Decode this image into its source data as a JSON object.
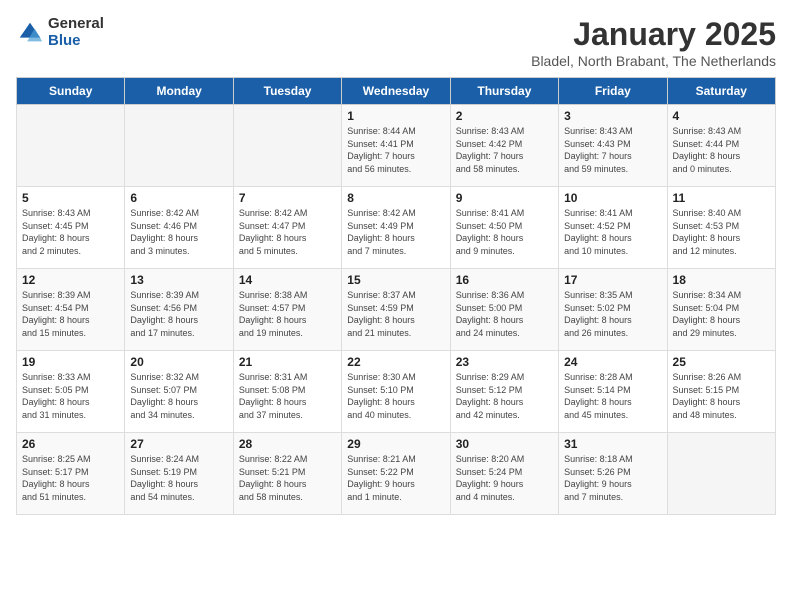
{
  "logo": {
    "general": "General",
    "blue": "Blue"
  },
  "header": {
    "title": "January 2025",
    "subtitle": "Bladel, North Brabant, The Netherlands"
  },
  "days_of_week": [
    "Sunday",
    "Monday",
    "Tuesday",
    "Wednesday",
    "Thursday",
    "Friday",
    "Saturday"
  ],
  "weeks": [
    [
      {
        "day": "",
        "info": ""
      },
      {
        "day": "",
        "info": ""
      },
      {
        "day": "",
        "info": ""
      },
      {
        "day": "1",
        "info": "Sunrise: 8:44 AM\nSunset: 4:41 PM\nDaylight: 7 hours\nand 56 minutes."
      },
      {
        "day": "2",
        "info": "Sunrise: 8:43 AM\nSunset: 4:42 PM\nDaylight: 7 hours\nand 58 minutes."
      },
      {
        "day": "3",
        "info": "Sunrise: 8:43 AM\nSunset: 4:43 PM\nDaylight: 7 hours\nand 59 minutes."
      },
      {
        "day": "4",
        "info": "Sunrise: 8:43 AM\nSunset: 4:44 PM\nDaylight: 8 hours\nand 0 minutes."
      }
    ],
    [
      {
        "day": "5",
        "info": "Sunrise: 8:43 AM\nSunset: 4:45 PM\nDaylight: 8 hours\nand 2 minutes."
      },
      {
        "day": "6",
        "info": "Sunrise: 8:42 AM\nSunset: 4:46 PM\nDaylight: 8 hours\nand 3 minutes."
      },
      {
        "day": "7",
        "info": "Sunrise: 8:42 AM\nSunset: 4:47 PM\nDaylight: 8 hours\nand 5 minutes."
      },
      {
        "day": "8",
        "info": "Sunrise: 8:42 AM\nSunset: 4:49 PM\nDaylight: 8 hours\nand 7 minutes."
      },
      {
        "day": "9",
        "info": "Sunrise: 8:41 AM\nSunset: 4:50 PM\nDaylight: 8 hours\nand 9 minutes."
      },
      {
        "day": "10",
        "info": "Sunrise: 8:41 AM\nSunset: 4:52 PM\nDaylight: 8 hours\nand 10 minutes."
      },
      {
        "day": "11",
        "info": "Sunrise: 8:40 AM\nSunset: 4:53 PM\nDaylight: 8 hours\nand 12 minutes."
      }
    ],
    [
      {
        "day": "12",
        "info": "Sunrise: 8:39 AM\nSunset: 4:54 PM\nDaylight: 8 hours\nand 15 minutes."
      },
      {
        "day": "13",
        "info": "Sunrise: 8:39 AM\nSunset: 4:56 PM\nDaylight: 8 hours\nand 17 minutes."
      },
      {
        "day": "14",
        "info": "Sunrise: 8:38 AM\nSunset: 4:57 PM\nDaylight: 8 hours\nand 19 minutes."
      },
      {
        "day": "15",
        "info": "Sunrise: 8:37 AM\nSunset: 4:59 PM\nDaylight: 8 hours\nand 21 minutes."
      },
      {
        "day": "16",
        "info": "Sunrise: 8:36 AM\nSunset: 5:00 PM\nDaylight: 8 hours\nand 24 minutes."
      },
      {
        "day": "17",
        "info": "Sunrise: 8:35 AM\nSunset: 5:02 PM\nDaylight: 8 hours\nand 26 minutes."
      },
      {
        "day": "18",
        "info": "Sunrise: 8:34 AM\nSunset: 5:04 PM\nDaylight: 8 hours\nand 29 minutes."
      }
    ],
    [
      {
        "day": "19",
        "info": "Sunrise: 8:33 AM\nSunset: 5:05 PM\nDaylight: 8 hours\nand 31 minutes."
      },
      {
        "day": "20",
        "info": "Sunrise: 8:32 AM\nSunset: 5:07 PM\nDaylight: 8 hours\nand 34 minutes."
      },
      {
        "day": "21",
        "info": "Sunrise: 8:31 AM\nSunset: 5:08 PM\nDaylight: 8 hours\nand 37 minutes."
      },
      {
        "day": "22",
        "info": "Sunrise: 8:30 AM\nSunset: 5:10 PM\nDaylight: 8 hours\nand 40 minutes."
      },
      {
        "day": "23",
        "info": "Sunrise: 8:29 AM\nSunset: 5:12 PM\nDaylight: 8 hours\nand 42 minutes."
      },
      {
        "day": "24",
        "info": "Sunrise: 8:28 AM\nSunset: 5:14 PM\nDaylight: 8 hours\nand 45 minutes."
      },
      {
        "day": "25",
        "info": "Sunrise: 8:26 AM\nSunset: 5:15 PM\nDaylight: 8 hours\nand 48 minutes."
      }
    ],
    [
      {
        "day": "26",
        "info": "Sunrise: 8:25 AM\nSunset: 5:17 PM\nDaylight: 8 hours\nand 51 minutes."
      },
      {
        "day": "27",
        "info": "Sunrise: 8:24 AM\nSunset: 5:19 PM\nDaylight: 8 hours\nand 54 minutes."
      },
      {
        "day": "28",
        "info": "Sunrise: 8:22 AM\nSunset: 5:21 PM\nDaylight: 8 hours\nand 58 minutes."
      },
      {
        "day": "29",
        "info": "Sunrise: 8:21 AM\nSunset: 5:22 PM\nDaylight: 9 hours\nand 1 minute."
      },
      {
        "day": "30",
        "info": "Sunrise: 8:20 AM\nSunset: 5:24 PM\nDaylight: 9 hours\nand 4 minutes."
      },
      {
        "day": "31",
        "info": "Sunrise: 8:18 AM\nSunset: 5:26 PM\nDaylight: 9 hours\nand 7 minutes."
      },
      {
        "day": "",
        "info": ""
      }
    ]
  ]
}
